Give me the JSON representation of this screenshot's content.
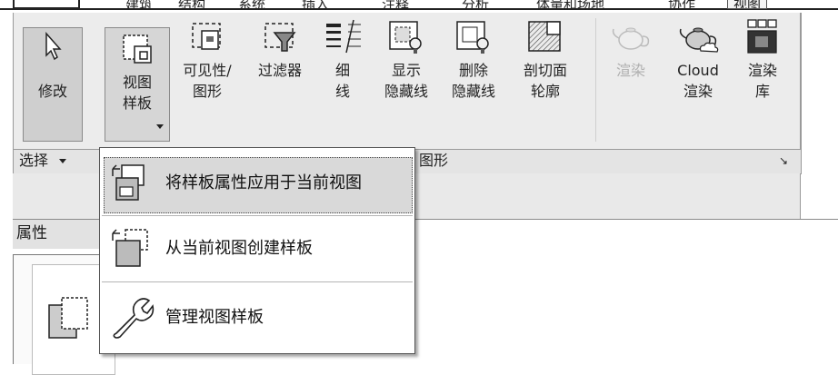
{
  "ribbon_tabs": [
    "建筑",
    "结构",
    "系统",
    "插入",
    "注释",
    "分析",
    "体量和场地",
    "协作",
    "视图"
  ],
  "active_tab": "视图",
  "ribbon_buttons": {
    "modify": {
      "line1": "修改",
      "icon": "cursor-arrow-icon"
    },
    "view_templates": {
      "line1": "视图",
      "line2": "样板",
      "icon": "view-template-icon"
    },
    "visibility_graphics": {
      "line1": "可见性/",
      "line2": "图形",
      "icon": "visibility-graphics-icon"
    },
    "filters": {
      "line1": "过滤器",
      "icon": "filter-icon"
    },
    "thin_lines": {
      "line1": "细",
      "line2": "线",
      "icon": "thin-lines-icon"
    },
    "show_hidden_lines": {
      "line1": "显示",
      "line2": "隐藏线",
      "icon": "show-hidden-lines-icon"
    },
    "remove_hidden_lines": {
      "line1": "删除",
      "line2": "隐藏线",
      "icon": "remove-hidden-lines-icon"
    },
    "cut_profile": {
      "line1": "剖切面",
      "line2": "轮廓",
      "icon": "cut-profile-icon"
    },
    "render": {
      "line1": "渲染",
      "icon": "teapot-icon"
    },
    "cloud_render": {
      "line1": "Cloud",
      "line2": "渲染",
      "icon": "cloud-teapot-icon"
    },
    "render_gallery": {
      "line1": "渲染",
      "line2": "库",
      "icon": "render-gallery-icon"
    }
  },
  "panel_labels": {
    "select": "选择",
    "graphics": "图形",
    "launcher": "↘"
  },
  "properties": {
    "title": "属性"
  },
  "view_template_menu": {
    "items": [
      {
        "label": "将样板属性应用于当前视图",
        "icon": "apply-template-icon"
      },
      {
        "label": "从当前视图创建样板",
        "icon": "create-template-icon"
      },
      {
        "label": "管理视图样板",
        "icon": "wrench-icon"
      }
    ]
  },
  "colors": {
    "ribbon_bg": "#ececec",
    "active_button_bg": "#d6d6d6",
    "menu_highlight": "#d9d9d9"
  }
}
